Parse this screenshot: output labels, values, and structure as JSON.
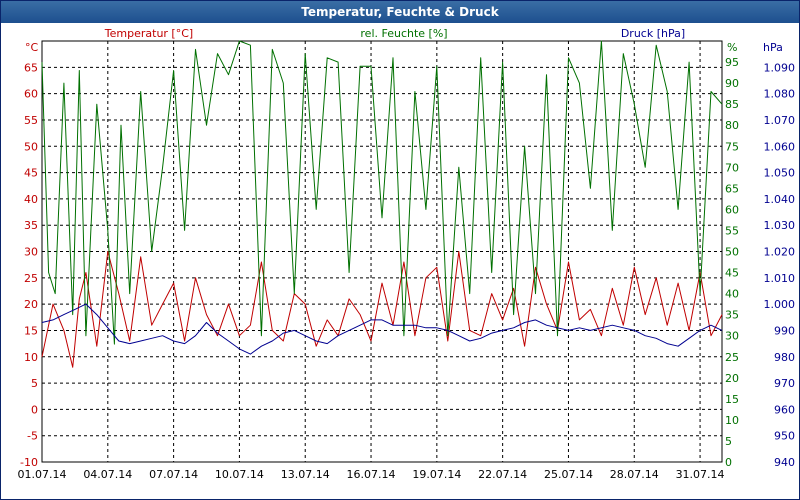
{
  "window": {
    "title": "Temperatur, Feuchte & Druck"
  },
  "chart_data": {
    "type": "line",
    "title": "Temperatur, Feuchte & Druck",
    "grid": true,
    "xlim": [
      "01.07.14",
      "01.08.14"
    ],
    "x_ticks": [
      "01.07.14",
      "04.07.14",
      "07.07.14",
      "10.07.14",
      "13.07.14",
      "16.07.14",
      "19.07.14",
      "22.07.14",
      "25.07.14",
      "28.07.14",
      "31.07.14"
    ],
    "axes": {
      "temperature": {
        "label": "Temperatur [°C]",
        "unit": "°C",
        "ylim": [
          -10,
          70
        ],
        "ticks": [
          -10,
          -5,
          0,
          5,
          10,
          15,
          20,
          25,
          30,
          35,
          40,
          45,
          50,
          55,
          60,
          65
        ],
        "color": "#c00000",
        "position": "left"
      },
      "humidity": {
        "label": "rel. Feuchte [%]",
        "unit": "%",
        "ylim": [
          0,
          100
        ],
        "ticks": [
          0,
          5,
          10,
          15,
          20,
          25,
          30,
          35,
          40,
          45,
          50,
          55,
          60,
          65,
          70,
          75,
          80,
          85,
          90,
          95
        ],
        "color": "#007000",
        "position": "right"
      },
      "pressure": {
        "label": "Druck [hPa]",
        "unit": "hPa",
        "ylim": [
          940,
          1100
        ],
        "ticks": [
          "940",
          "950",
          "960",
          "970",
          "980",
          "990",
          "1.000",
          "1.010",
          "1.020",
          "1.030",
          "1.040",
          "1.050",
          "1.060",
          "1.070",
          "1.080",
          "1.090"
        ],
        "color": "#000090",
        "position": "right"
      }
    },
    "series": [
      {
        "name": "Temperatur [°C]",
        "axis": "temperature",
        "color": "#c00000",
        "x": [
          1.0,
          1.5,
          2.0,
          2.4,
          2.7,
          3.0,
          3.5,
          4.0,
          4.5,
          5.0,
          5.5,
          6.0,
          6.5,
          7.0,
          7.5,
          8.0,
          8.5,
          9.0,
          9.5,
          10.0,
          10.5,
          11.0,
          11.5,
          12.0,
          12.5,
          13.0,
          13.5,
          14.0,
          14.5,
          15.0,
          15.5,
          16.0,
          16.5,
          17.0,
          17.5,
          18.0,
          18.5,
          19.0,
          19.5,
          20.0,
          20.5,
          21.0,
          21.5,
          22.0,
          22.5,
          23.0,
          23.5,
          24.0,
          24.5,
          25.0,
          25.5,
          26.0,
          26.5,
          27.0,
          27.5,
          28.0,
          28.5,
          29.0,
          29.5,
          30.0,
          30.5,
          31.0,
          31.5,
          32.0
        ],
        "y": [
          10,
          20,
          15,
          8,
          21,
          26,
          12,
          30,
          22,
          13,
          29,
          16,
          20,
          24,
          13,
          25,
          18,
          14,
          20,
          14,
          16,
          28,
          15,
          13,
          22,
          20,
          12,
          17,
          14,
          21,
          18,
          13,
          24,
          16,
          28,
          14,
          25,
          27,
          13,
          30,
          15,
          14,
          22,
          17,
          23,
          12,
          27,
          20,
          15,
          28,
          17,
          19,
          14,
          23,
          16,
          27,
          18,
          25,
          16,
          24,
          15,
          26,
          14,
          18
        ],
        "hidden_x": null
      },
      {
        "name": "rel. Feuchte [%]",
        "axis": "humidity",
        "color": "#007000",
        "x": [
          1.0,
          1.3,
          1.6,
          2.0,
          2.4,
          2.7,
          3.0,
          3.5,
          4.0,
          4.3,
          4.6,
          5.0,
          5.5,
          6.0,
          6.5,
          7.0,
          7.5,
          8.0,
          8.5,
          9.0,
          9.5,
          10.0,
          10.5,
          11.0,
          11.5,
          12.0,
          12.5,
          13.0,
          13.5,
          14.0,
          14.5,
          15.0,
          15.5,
          16.0,
          16.5,
          17.0,
          17.5,
          18.0,
          18.5,
          19.0,
          19.5,
          20.0,
          20.5,
          21.0,
          21.5,
          22.0,
          22.5,
          23.0,
          23.5,
          24.0,
          24.5,
          25.0,
          25.5,
          26.0,
          26.5,
          27.0,
          27.5,
          28.0,
          28.5,
          29.0,
          29.5,
          30.0,
          30.5,
          31.0,
          31.5,
          32.0
        ],
        "y": [
          95,
          45,
          40,
          90,
          35,
          93,
          30,
          85,
          55,
          28,
          80,
          40,
          88,
          50,
          70,
          93,
          55,
          98,
          80,
          97,
          92,
          100,
          99,
          30,
          98,
          90,
          40,
          97,
          60,
          96,
          95,
          45,
          94,
          94,
          58,
          96,
          30,
          88,
          60,
          94,
          30,
          70,
          40,
          96,
          45,
          95,
          35,
          75,
          40,
          92,
          30,
          96,
          90,
          65,
          100,
          55,
          97,
          85,
          70,
          99,
          88,
          60,
          95,
          40,
          88,
          85
        ],
        "hidden_x": null
      },
      {
        "name": "Druck [hPa]",
        "axis": "pressure",
        "color": "#000090",
        "x": [
          1.0,
          1.5,
          2.0,
          2.5,
          3.0,
          3.5,
          4.0,
          4.5,
          5.0,
          5.5,
          6.0,
          6.5,
          7.0,
          7.5,
          8.0,
          8.5,
          9.0,
          9.5,
          10.0,
          10.5,
          11.0,
          11.5,
          12.0,
          12.5,
          13.0,
          13.5,
          14.0,
          14.5,
          15.0,
          15.5,
          16.0,
          16.5,
          17.0,
          17.5,
          18.0,
          18.5,
          19.0,
          19.5,
          20.0,
          20.5,
          21.0,
          21.5,
          22.0,
          22.5,
          23.0,
          23.5,
          24.0,
          24.5,
          25.0,
          25.5,
          26.0,
          26.5,
          27.0,
          27.5,
          28.0,
          28.5,
          29.0,
          29.5,
          30.0,
          30.5,
          31.0,
          31.5,
          32.0
        ],
        "y": [
          993,
          994,
          996,
          998,
          1000,
          996,
          991,
          986,
          985,
          986,
          987,
          988,
          986,
          985,
          988,
          993,
          989,
          986,
          983,
          981,
          984,
          986,
          989,
          990,
          988,
          986,
          985,
          988,
          990,
          992,
          994,
          994,
          992,
          992,
          992,
          991,
          991,
          990,
          988,
          986,
          987,
          989,
          990,
          991,
          993,
          994,
          992,
          991,
          990,
          991,
          990,
          991,
          992,
          991,
          990,
          988,
          987,
          985,
          984,
          987,
          990,
          992,
          990
        ],
        "hidden_x": null
      }
    ]
  }
}
